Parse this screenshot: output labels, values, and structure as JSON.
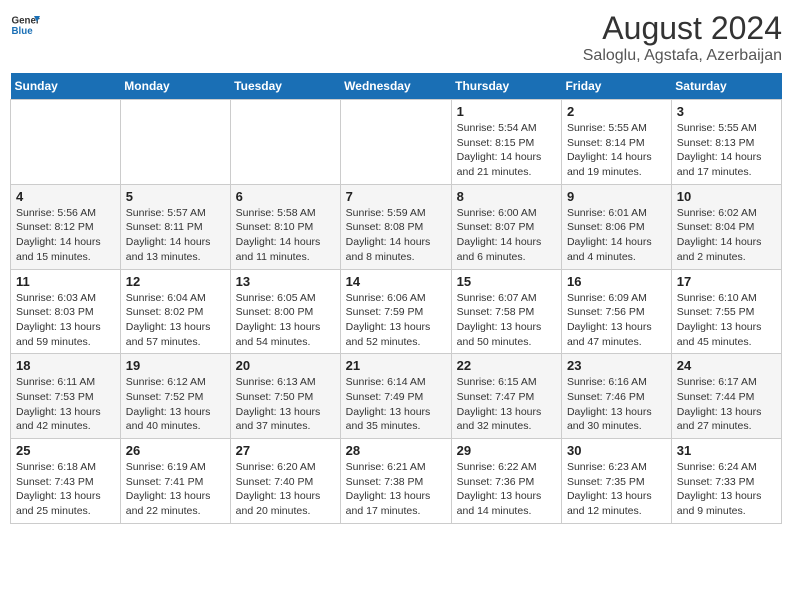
{
  "header": {
    "logo_line1": "General",
    "logo_line2": "Blue",
    "main_title": "August 2024",
    "subtitle": "Saloglu, Agstafa, Azerbaijan"
  },
  "days_of_week": [
    "Sunday",
    "Monday",
    "Tuesday",
    "Wednesday",
    "Thursday",
    "Friday",
    "Saturday"
  ],
  "weeks": [
    [
      {
        "day": "",
        "detail": ""
      },
      {
        "day": "",
        "detail": ""
      },
      {
        "day": "",
        "detail": ""
      },
      {
        "day": "",
        "detail": ""
      },
      {
        "day": "1",
        "detail": "Sunrise: 5:54 AM\nSunset: 8:15 PM\nDaylight: 14 hours\nand 21 minutes."
      },
      {
        "day": "2",
        "detail": "Sunrise: 5:55 AM\nSunset: 8:14 PM\nDaylight: 14 hours\nand 19 minutes."
      },
      {
        "day": "3",
        "detail": "Sunrise: 5:55 AM\nSunset: 8:13 PM\nDaylight: 14 hours\nand 17 minutes."
      }
    ],
    [
      {
        "day": "4",
        "detail": "Sunrise: 5:56 AM\nSunset: 8:12 PM\nDaylight: 14 hours\nand 15 minutes."
      },
      {
        "day": "5",
        "detail": "Sunrise: 5:57 AM\nSunset: 8:11 PM\nDaylight: 14 hours\nand 13 minutes."
      },
      {
        "day": "6",
        "detail": "Sunrise: 5:58 AM\nSunset: 8:10 PM\nDaylight: 14 hours\nand 11 minutes."
      },
      {
        "day": "7",
        "detail": "Sunrise: 5:59 AM\nSunset: 8:08 PM\nDaylight: 14 hours\nand 8 minutes."
      },
      {
        "day": "8",
        "detail": "Sunrise: 6:00 AM\nSunset: 8:07 PM\nDaylight: 14 hours\nand 6 minutes."
      },
      {
        "day": "9",
        "detail": "Sunrise: 6:01 AM\nSunset: 8:06 PM\nDaylight: 14 hours\nand 4 minutes."
      },
      {
        "day": "10",
        "detail": "Sunrise: 6:02 AM\nSunset: 8:04 PM\nDaylight: 14 hours\nand 2 minutes."
      }
    ],
    [
      {
        "day": "11",
        "detail": "Sunrise: 6:03 AM\nSunset: 8:03 PM\nDaylight: 13 hours\nand 59 minutes."
      },
      {
        "day": "12",
        "detail": "Sunrise: 6:04 AM\nSunset: 8:02 PM\nDaylight: 13 hours\nand 57 minutes."
      },
      {
        "day": "13",
        "detail": "Sunrise: 6:05 AM\nSunset: 8:00 PM\nDaylight: 13 hours\nand 54 minutes."
      },
      {
        "day": "14",
        "detail": "Sunrise: 6:06 AM\nSunset: 7:59 PM\nDaylight: 13 hours\nand 52 minutes."
      },
      {
        "day": "15",
        "detail": "Sunrise: 6:07 AM\nSunset: 7:58 PM\nDaylight: 13 hours\nand 50 minutes."
      },
      {
        "day": "16",
        "detail": "Sunrise: 6:09 AM\nSunset: 7:56 PM\nDaylight: 13 hours\nand 47 minutes."
      },
      {
        "day": "17",
        "detail": "Sunrise: 6:10 AM\nSunset: 7:55 PM\nDaylight: 13 hours\nand 45 minutes."
      }
    ],
    [
      {
        "day": "18",
        "detail": "Sunrise: 6:11 AM\nSunset: 7:53 PM\nDaylight: 13 hours\nand 42 minutes."
      },
      {
        "day": "19",
        "detail": "Sunrise: 6:12 AM\nSunset: 7:52 PM\nDaylight: 13 hours\nand 40 minutes."
      },
      {
        "day": "20",
        "detail": "Sunrise: 6:13 AM\nSunset: 7:50 PM\nDaylight: 13 hours\nand 37 minutes."
      },
      {
        "day": "21",
        "detail": "Sunrise: 6:14 AM\nSunset: 7:49 PM\nDaylight: 13 hours\nand 35 minutes."
      },
      {
        "day": "22",
        "detail": "Sunrise: 6:15 AM\nSunset: 7:47 PM\nDaylight: 13 hours\nand 32 minutes."
      },
      {
        "day": "23",
        "detail": "Sunrise: 6:16 AM\nSunset: 7:46 PM\nDaylight: 13 hours\nand 30 minutes."
      },
      {
        "day": "24",
        "detail": "Sunrise: 6:17 AM\nSunset: 7:44 PM\nDaylight: 13 hours\nand 27 minutes."
      }
    ],
    [
      {
        "day": "25",
        "detail": "Sunrise: 6:18 AM\nSunset: 7:43 PM\nDaylight: 13 hours\nand 25 minutes."
      },
      {
        "day": "26",
        "detail": "Sunrise: 6:19 AM\nSunset: 7:41 PM\nDaylight: 13 hours\nand 22 minutes."
      },
      {
        "day": "27",
        "detail": "Sunrise: 6:20 AM\nSunset: 7:40 PM\nDaylight: 13 hours\nand 20 minutes."
      },
      {
        "day": "28",
        "detail": "Sunrise: 6:21 AM\nSunset: 7:38 PM\nDaylight: 13 hours\nand 17 minutes."
      },
      {
        "day": "29",
        "detail": "Sunrise: 6:22 AM\nSunset: 7:36 PM\nDaylight: 13 hours\nand 14 minutes."
      },
      {
        "day": "30",
        "detail": "Sunrise: 6:23 AM\nSunset: 7:35 PM\nDaylight: 13 hours\nand 12 minutes."
      },
      {
        "day": "31",
        "detail": "Sunrise: 6:24 AM\nSunset: 7:33 PM\nDaylight: 13 hours\nand 9 minutes."
      }
    ]
  ]
}
